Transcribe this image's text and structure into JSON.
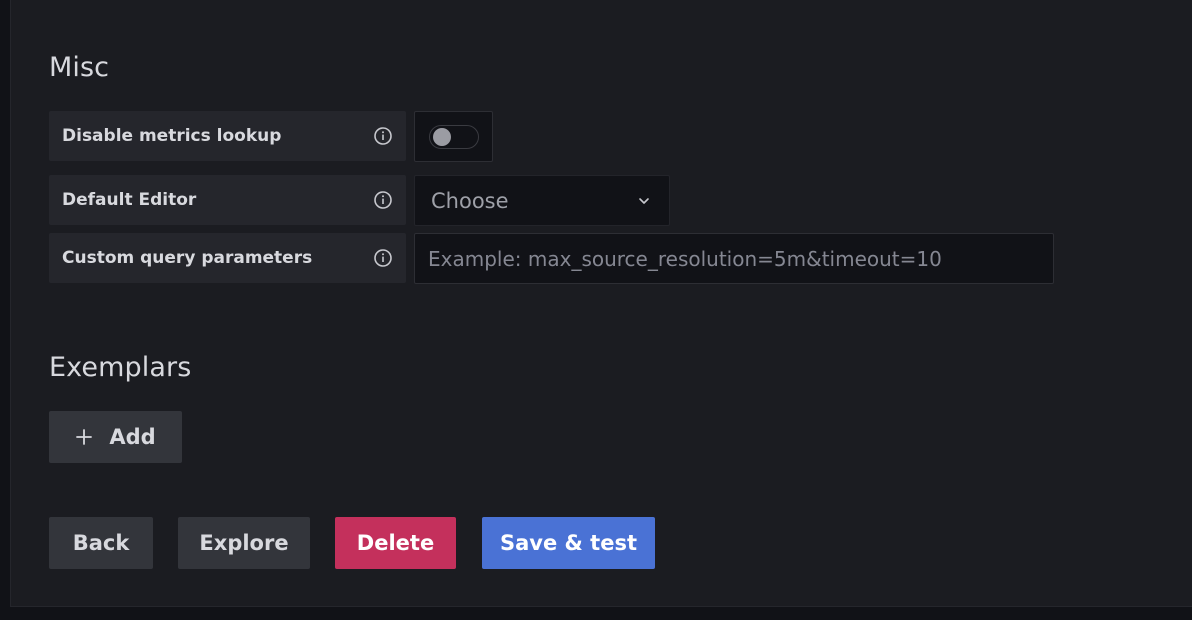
{
  "misc": {
    "title": "Misc",
    "disable_metrics_lookup": {
      "label": "Disable metrics lookup",
      "enabled": false
    },
    "default_editor": {
      "label": "Default Editor",
      "selected": "Choose"
    },
    "custom_query_parameters": {
      "label": "Custom query parameters",
      "value": "",
      "placeholder": "Example: max_source_resolution=5m&timeout=10"
    }
  },
  "exemplars": {
    "title": "Exemplars",
    "add_label": "Add"
  },
  "actions": {
    "back": "Back",
    "explore": "Explore",
    "delete": "Delete",
    "save_test": "Save & test"
  },
  "colors": {
    "page_bg": "#111217",
    "panel_bg": "#1b1c21",
    "label_bg": "#25262c",
    "secondary_button": "#33353b",
    "danger_button": "#c4305c",
    "primary_button": "#4a72d5",
    "text": "#d8d9de"
  },
  "icons": {
    "info": "info-circle-icon",
    "chevron": "chevron-down-icon",
    "plus": "plus-icon"
  }
}
